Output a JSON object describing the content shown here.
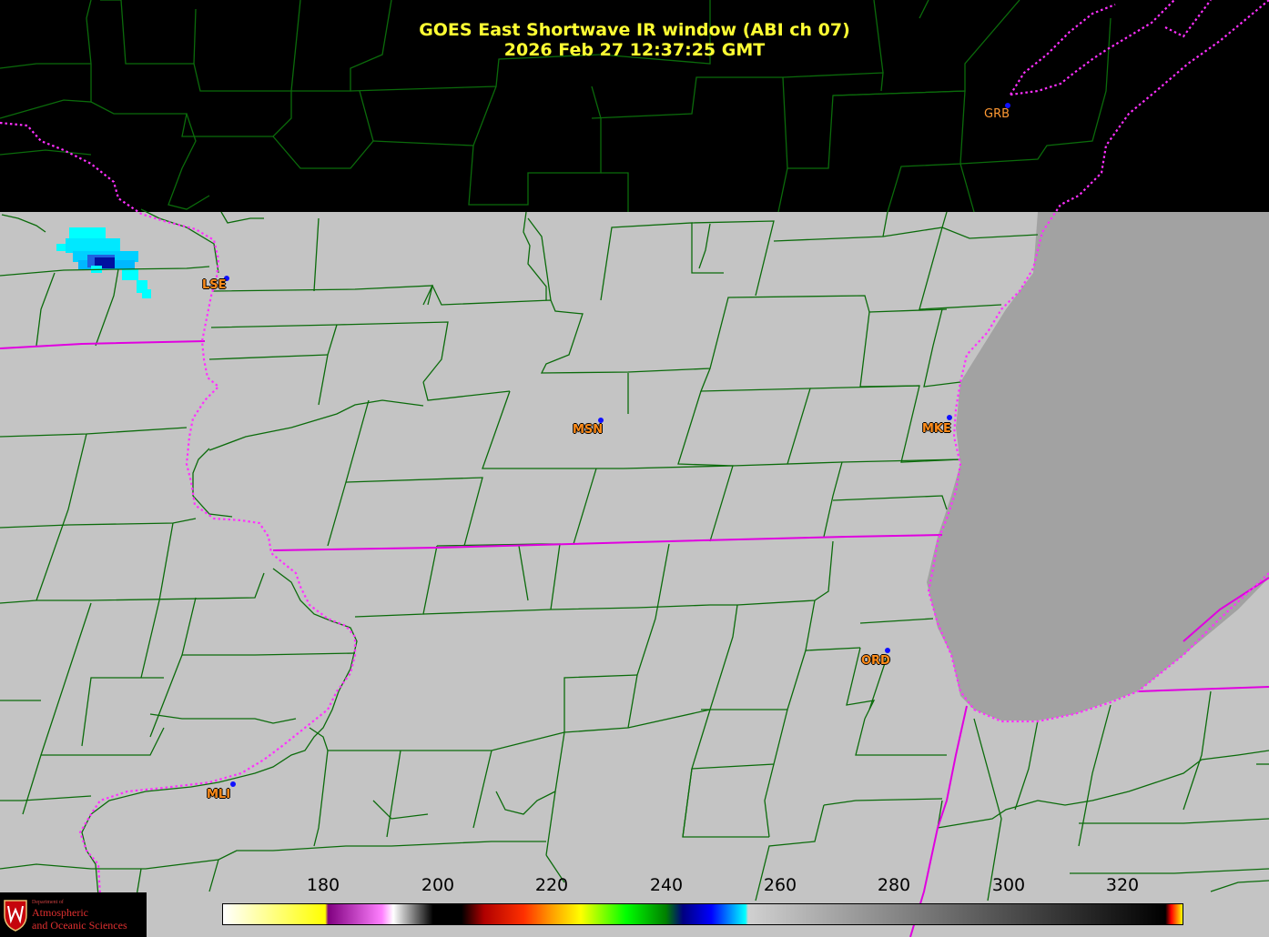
{
  "title": {
    "line1": "GOES East Shortwave IR window (ABI ch 07)",
    "line2": "2026 Feb 27  12:37:25 GMT"
  },
  "stations": [
    {
      "id": "LSE"
    },
    {
      "id": "MSN"
    },
    {
      "id": "MKE"
    },
    {
      "id": "ORD"
    },
    {
      "id": "MLI"
    },
    {
      "id": "GRB"
    }
  ],
  "colorbar": {
    "ticks": [
      "180",
      "200",
      "220",
      "240",
      "260",
      "280",
      "300",
      "320"
    ],
    "range": [
      162,
      331
    ],
    "stops": [
      {
        "value": 162,
        "color": "#ffffff"
      },
      {
        "value": 180,
        "color": "#ffff00"
      },
      {
        "value": 180.5,
        "color": "#800080"
      },
      {
        "value": 190,
        "color": "#ff80ff"
      },
      {
        "value": 192,
        "color": "#ffffff"
      },
      {
        "value": 199,
        "color": "#000000"
      },
      {
        "value": 204,
        "color": "#000000"
      },
      {
        "value": 208,
        "color": "#b00000"
      },
      {
        "value": 215,
        "color": "#ff3000"
      },
      {
        "value": 220,
        "color": "#ffa000"
      },
      {
        "value": 225,
        "color": "#ffff00"
      },
      {
        "value": 233,
        "color": "#00ff00"
      },
      {
        "value": 240,
        "color": "#008000"
      },
      {
        "value": 243,
        "color": "#000080"
      },
      {
        "value": 248,
        "color": "#0000ff"
      },
      {
        "value": 254,
        "color": "#00ffff"
      },
      {
        "value": 254.5,
        "color": "#d0d0d0"
      },
      {
        "value": 328,
        "color": "#000000"
      },
      {
        "value": 329,
        "color": "#ff0000"
      },
      {
        "value": 331,
        "color": "#ffff00"
      }
    ]
  },
  "logo": {
    "line1": "Department of",
    "line2": "Atmospheric",
    "line3": "and Oceanic Sciences"
  },
  "colors": {
    "title": "#ffff33",
    "county_lines": "#0b6b0b",
    "state_lines": "#e000e0",
    "station_label": "#ff8c1a",
    "station_dot": "#1010ff",
    "land": "#c4c4c4",
    "lake": "#a2a2a2",
    "cold_cloud": "#00ffff"
  }
}
